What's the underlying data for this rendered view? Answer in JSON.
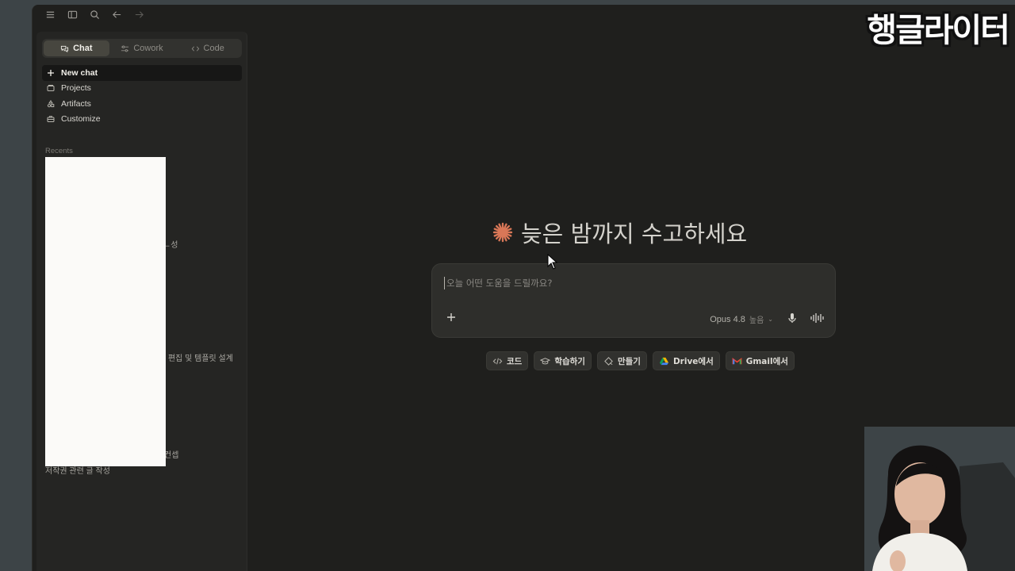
{
  "sidebar": {
    "modes": [
      {
        "label": "Chat",
        "icon": "chat-bubbles-icon",
        "active": true
      },
      {
        "label": "Cowork",
        "icon": "sliders-icon",
        "active": false
      },
      {
        "label": "Code",
        "icon": "code-brackets-icon",
        "active": false
      }
    ],
    "nav": [
      {
        "label": "New chat",
        "icon": "plus-icon"
      },
      {
        "label": "Projects",
        "icon": "folder-icon"
      },
      {
        "label": "Artifacts",
        "icon": "shapes-icon"
      },
      {
        "label": "Customize",
        "icon": "briefcase-icon"
      }
    ],
    "recents_label": "Recents",
    "recents_visible_fragments": [
      "ㄴ성",
      "ㅏ 편집 및 템플릿 설계",
      "컨셉",
      "저작권 관련 글 작성"
    ]
  },
  "main": {
    "greeting": "늦은 밤까지 수고하세요",
    "composer": {
      "placeholder": "오늘 어떤 도움을 드릴까요?",
      "model": "Opus 4.8",
      "effort": "높음"
    },
    "chips": [
      {
        "label": "코드",
        "icon": "code-icon"
      },
      {
        "label": "학습하기",
        "icon": "graduation-cap-icon"
      },
      {
        "label": "만들기",
        "icon": "paint-icon"
      },
      {
        "label": "Drive에서",
        "icon": "google-drive-icon"
      },
      {
        "label": "Gmail에서",
        "icon": "gmail-icon"
      }
    ]
  },
  "overlay": {
    "channel_name": "행글라이터"
  },
  "colors": {
    "accent": "#d97757",
    "background": "#1f1f1d",
    "sidebar": "#252523"
  }
}
